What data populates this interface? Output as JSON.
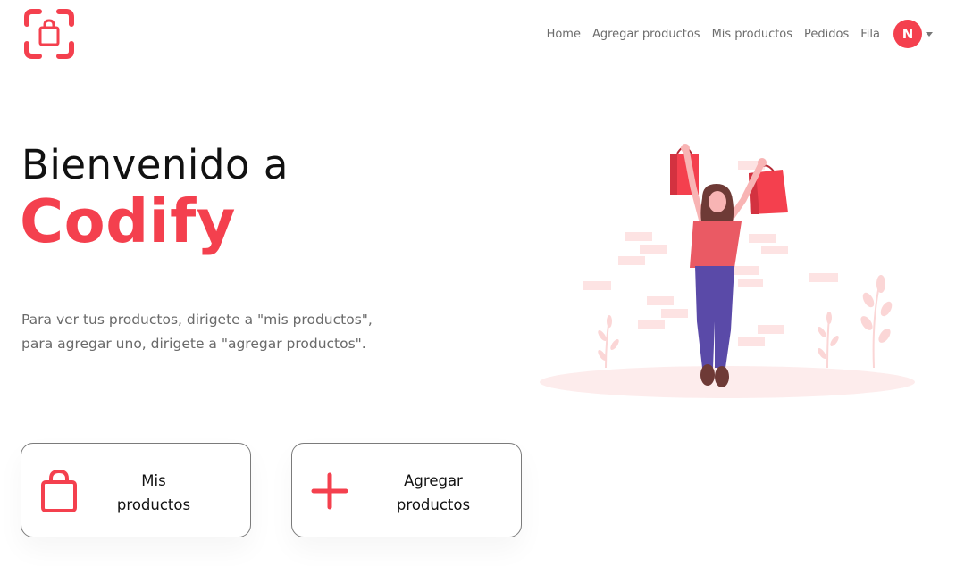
{
  "colors": {
    "brand": "#f4404e",
    "text_muted": "#6a6a6a",
    "nav_text": "#6c6c6c"
  },
  "header": {
    "logo_icon": "shopping-bag-scan-icon",
    "nav": [
      {
        "label": "Home"
      },
      {
        "label": "Agregar productos"
      },
      {
        "label": "Mis productos"
      },
      {
        "label": "Pedidos"
      },
      {
        "label": "Fila"
      }
    ],
    "user": {
      "initial": "N",
      "menu_icon": "caret-down-icon"
    }
  },
  "hero": {
    "title": "Bienvenido a",
    "brand": "Codify",
    "description_line1": "Para ver tus productos, dirigete a \"mis productos\",",
    "description_line2": "para agregar uno, dirigete a \"agregar productos\".",
    "illustration": "woman-shopping-illustration"
  },
  "cards": [
    {
      "icon": "shopping-bag-icon",
      "line1": "Mis",
      "line2": "productos"
    },
    {
      "icon": "plus-icon",
      "line1": "Agregar",
      "line2": "productos"
    }
  ]
}
